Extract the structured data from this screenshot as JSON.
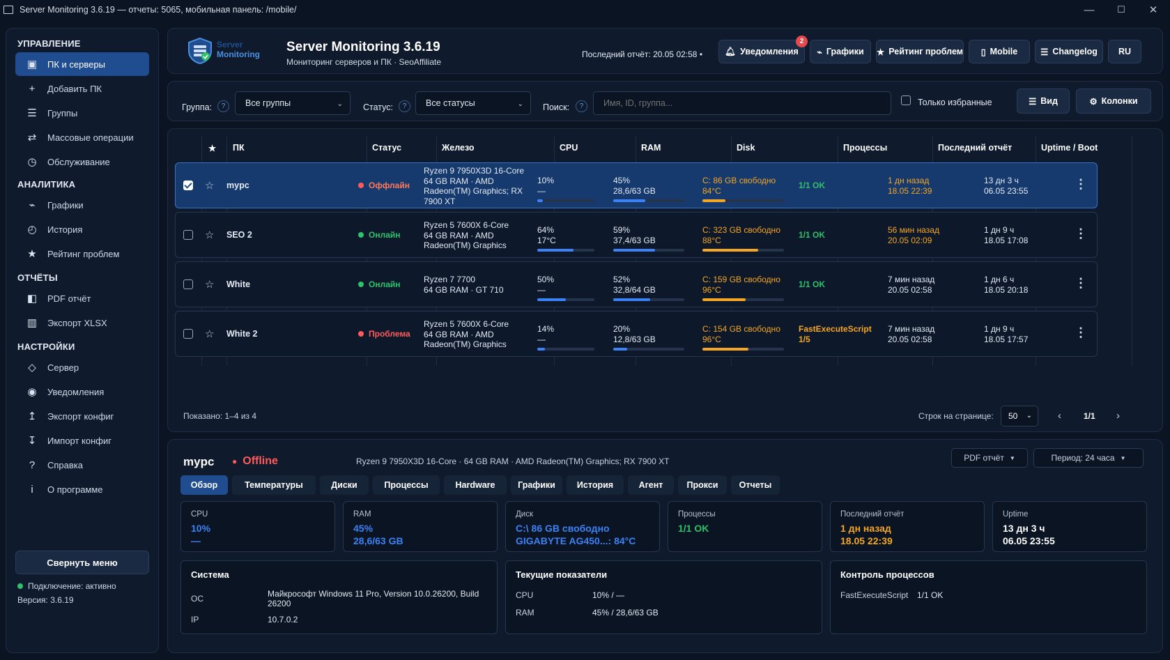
{
  "window": {
    "title": "Server Monitoring 3.6.19 — отчеты: 5065, мобильная панель: /mobile/"
  },
  "sidebar": {
    "sections": {
      "management": "УПРАВЛЕНИЕ",
      "analytics": "АНАЛИТИКА",
      "reports": "ОТЧЁТЫ",
      "settings": "НАСТРОЙКИ"
    },
    "items": [
      "ПК и серверы",
      "Добавить ПК",
      "Группы",
      "Массовые операции",
      "Обслуживание",
      "Графики",
      "История",
      "Рейтинг проблем",
      "PDF отчёт",
      "Экспорт XLSX",
      "Сервер",
      "Уведомления",
      "Экспорт конфиг",
      "Импорт конфиг",
      "Справка",
      "О программе"
    ],
    "icons": [
      "▣",
      "+",
      "☰",
      "⇄",
      "◷",
      "⌁",
      "◴",
      "★",
      "◧",
      "▥",
      "◇",
      "◉",
      "↥",
      "↧",
      "?",
      "i"
    ],
    "collapse_label": "Свернуть меню",
    "connection": "Подключение: активно",
    "version": "Версия: 3.6.19"
  },
  "header": {
    "logo_text_1": "Server",
    "logo_text_2": "Monitoring",
    "title": "Server Monitoring 3.6.19",
    "subtitle": "Мониторинг серверов и ПК · SeoAffiliate",
    "last_report": "Последний отчёт: 20.05 02:58",
    "notifications": "Уведомления",
    "notifications_count": "2",
    "charts": "Графики",
    "rating": "Рейтинг проблем",
    "mobile": "Mobile",
    "changelog": "Changelog",
    "lang": "RU"
  },
  "filters": {
    "group_label": "Группа:",
    "group_value": "Все группы",
    "status_label": "Статус:",
    "status_value": "Все статусы",
    "search_label": "Поиск:",
    "search_placeholder": "Имя, ID, группа...",
    "favorites_label": "Только избранные",
    "view_button": "Вид",
    "columns_button": "Колонки"
  },
  "table": {
    "headers": [
      "★",
      "ПК",
      "Статус",
      "Железо",
      "CPU",
      "RAM",
      "Disk",
      "Процессы",
      "Последний отчёт",
      "Uptime / Boot"
    ],
    "rows": [
      {
        "name": "mypc",
        "status": "Оффлайн",
        "hw1": "Ryzen 9 7950X3D 16-Core",
        "hw2": "64 GB RAM · AMD",
        "hw3": "Radeon(TM) Graphics; RX",
        "hw4": "7900 XT",
        "cpu1": "10%",
        "cpu2": "—",
        "cpu_pct": 10,
        "ram1": "45%",
        "ram2": "28,6/63 GB",
        "ram_pct": 45,
        "disk1": "C: 86 GB свободно",
        "disk2": "84°C",
        "disk_pct": 28,
        "proc1": "1/1 OK",
        "proc2": "",
        "rep1": "1 дн назад",
        "rep2": "18.05 22:39",
        "up1": "13 дн 3 ч",
        "up2": "06.05 23:55"
      },
      {
        "name": "SEO 2",
        "status": "Онлайн",
        "hw1": "Ryzen 5 7600X 6-Core",
        "hw2": "64 GB RAM · AMD",
        "hw3": "Radeon(TM) Graphics",
        "hw4": "",
        "cpu1": "64%",
        "cpu2": "17°C",
        "cpu_pct": 64,
        "ram1": "59%",
        "ram2": "37,4/63 GB",
        "ram_pct": 59,
        "disk1": "C: 323 GB свободно",
        "disk2": "88°C",
        "disk_pct": 68,
        "proc1": "1/1 OK",
        "proc2": "",
        "rep1": "56 мин назад",
        "rep2": "20.05 02:09",
        "up1": "1 дн 9 ч",
        "up2": "18.05 17:08"
      },
      {
        "name": "White",
        "status": "Онлайн",
        "hw1": "Ryzen 7 7700",
        "hw2": "64 GB RAM · GT 710",
        "hw3": "",
        "hw4": "",
        "cpu1": "50%",
        "cpu2": "—",
        "cpu_pct": 50,
        "ram1": "52%",
        "ram2": "32,8/64 GB",
        "ram_pct": 52,
        "disk1": "C: 159 GB свободно",
        "disk2": "96°C",
        "disk_pct": 53,
        "proc1": "1/1 OK",
        "proc2": "",
        "rep1": "7 мин назад",
        "rep2": "20.05 02:58",
        "up1": "1 дн 6 ч",
        "up2": "18.05 20:18"
      },
      {
        "name": "White 2",
        "status": "Проблема",
        "hw1": "Ryzen 5 7600X 6-Core",
        "hw2": "64 GB RAM · AMD",
        "hw3": "Radeon(TM) Graphics",
        "hw4": "",
        "cpu1": "14%",
        "cpu2": "—",
        "cpu_pct": 14,
        "ram1": "20%",
        "ram2": "12,8/63 GB",
        "ram_pct": 20,
        "disk1": "C: 154 GB свободно",
        "disk2": "96°C",
        "disk_pct": 56,
        "proc1": "FastExecuteScript",
        "proc2": "1/5",
        "rep1": "7 мин назад",
        "rep2": "20.05 02:58",
        "up1": "1 дн 9 ч",
        "up2": "18.05 17:57"
      }
    ],
    "shown": "Показано: 1–4 из 4",
    "rows_per_page_label": "Строк на странице:",
    "rows_per_page": "50",
    "page": "1/1",
    "prev": "‹",
    "next": "›"
  },
  "detail": {
    "name": "mypc",
    "status": "Offline",
    "hardware": "Ryzen 9 7950X3D 16-Core · 64 GB RAM · AMD Radeon(TM) Graphics; RX 7900 XT",
    "pdf_button": "PDF отчёт",
    "period_button": "Период: 24 часа",
    "tabs": [
      "Обзор",
      "Температуры",
      "Диски",
      "Процессы",
      "Hardware",
      "Графики",
      "История",
      "Агент",
      "Прокси",
      "Отчеты"
    ],
    "cards": [
      {
        "label": "CPU",
        "v1": "10%",
        "v2": "—"
      },
      {
        "label": "RAM",
        "v1": "45%",
        "v2": "28,6/63 GB"
      },
      {
        "label": "Диск",
        "v1": "C:\\ 86 GB свободно",
        "v2": "GIGABYTE AG450...: 84°C"
      },
      {
        "label": "Процессы",
        "v1": "",
        "v2": "1/1 OK"
      },
      {
        "label": "Последний отчёт",
        "v1": "1 дн назад",
        "v2": "18.05 22:39"
      },
      {
        "label": "Uptime",
        "v1": "13 дн 3 ч",
        "v2": "06.05 23:55"
      }
    ],
    "system": {
      "title": "Система",
      "os_label": "ОС",
      "os_value1": "Майкрософт Windows 11 Pro, Version 10.0.26200, Build",
      "os_value2": "26200",
      "ip_label": "IP",
      "ip_value": "10.7.0.2"
    },
    "current": {
      "title": "Текущие показатели",
      "cpu_label": "CPU",
      "cpu_value": "10% / —",
      "ram_label": "RAM",
      "ram_value": "45% / 28,6/63 GB"
    },
    "process_control": {
      "title": "Контроль процессов",
      "name": "FastExecuteScript",
      "value": "1/1 OK"
    }
  },
  "colors": {
    "accent": "#1f4d8f",
    "ok": "#2ec26a",
    "offline": "#ff5a5a",
    "warn": "#f5a623",
    "blue": "#3b82f6"
  }
}
